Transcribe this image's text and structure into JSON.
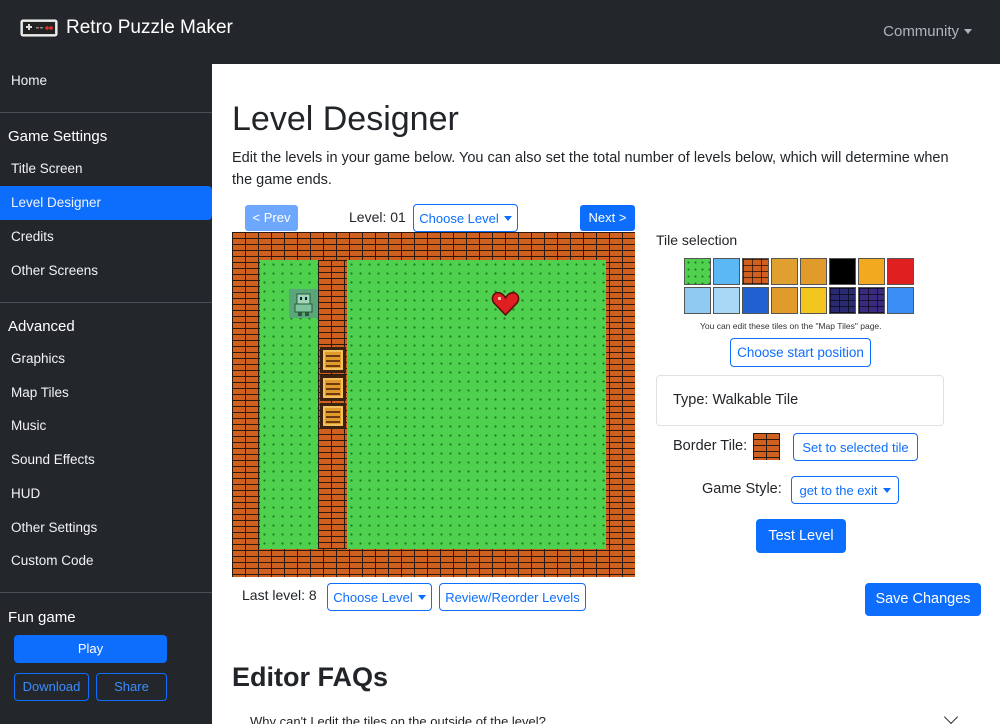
{
  "app": {
    "title": "Retro Puzzle Maker",
    "logo_icon": "gamepad-icon",
    "community_label": "Community"
  },
  "sidebar": {
    "home": "Home",
    "game_settings_heading": "Game Settings",
    "game_settings_items": [
      "Title Screen",
      "Level Designer",
      "Credits",
      "Other Screens"
    ],
    "active_item": "Level Designer",
    "advanced_heading": "Advanced",
    "advanced_items": [
      "Graphics",
      "Map Tiles",
      "Music",
      "Sound Effects",
      "HUD",
      "Other Settings",
      "Custom Code"
    ],
    "fun_game_heading": "Fun game",
    "play_label": "Play",
    "download_label": "Download",
    "share_label": "Share"
  },
  "main": {
    "title": "Level Designer",
    "intro": "Edit the levels in your game below. You can also set the total number of levels below, which will determine when the game ends.",
    "prev_label": "< Prev",
    "next_label": "Next >",
    "level_label": "Level: 01",
    "choose_level_label": "Choose Level",
    "last_level_label": "Last level: 8",
    "review_label": "Review/Reorder Levels",
    "save_label": "Save Changes",
    "faq_title": "Editor FAQs",
    "faq_first_question": "Why can't I edit the tiles on the outside of the level?"
  },
  "tiles": {
    "heading": "Tile selection",
    "note": "You can edit these tiles on the \"Map Tiles\" page.",
    "palette": [
      {
        "name": "grass-tile",
        "color": "#4fd04f"
      },
      {
        "name": "ice-tile",
        "color": "#5bb8f5"
      },
      {
        "name": "brick-tile",
        "color": "#d0601f"
      },
      {
        "name": "spike-block-tile",
        "color": "#e0a030"
      },
      {
        "name": "crate-tile",
        "color": "#e09b2a"
      },
      {
        "name": "void-tile",
        "color": "#000000"
      },
      {
        "name": "coin-tile",
        "color": "#f2a91f"
      },
      {
        "name": "heart-tile",
        "color": "#e02020"
      },
      {
        "name": "dotted-ice-tile",
        "color": "#8fcaf2"
      },
      {
        "name": "glass-tile",
        "color": "#a8d8f5"
      },
      {
        "name": "blue-pedestal-tile",
        "color": "#2060d0"
      },
      {
        "name": "locked-crate-tile",
        "color": "#e09b2a"
      },
      {
        "name": "key-tile",
        "color": "#f2c61f"
      },
      {
        "name": "dark-brick-tile",
        "color": "#2a2a70"
      },
      {
        "name": "purple-brick-tile",
        "color": "#3a2a80"
      },
      {
        "name": "water-tile",
        "color": "#3a8ef5"
      }
    ],
    "choose_start_label": "Choose start position",
    "type_label": "Type: Walkable Tile",
    "border_tile_label": "Border Tile:",
    "set_selected_label": "Set to selected tile",
    "game_style_label": "Game Style:",
    "game_style_value": "get to the exit",
    "test_level_label": "Test Level"
  },
  "colors": {
    "primary": "#0d6efd",
    "sidebar_bg": "#23272b"
  }
}
